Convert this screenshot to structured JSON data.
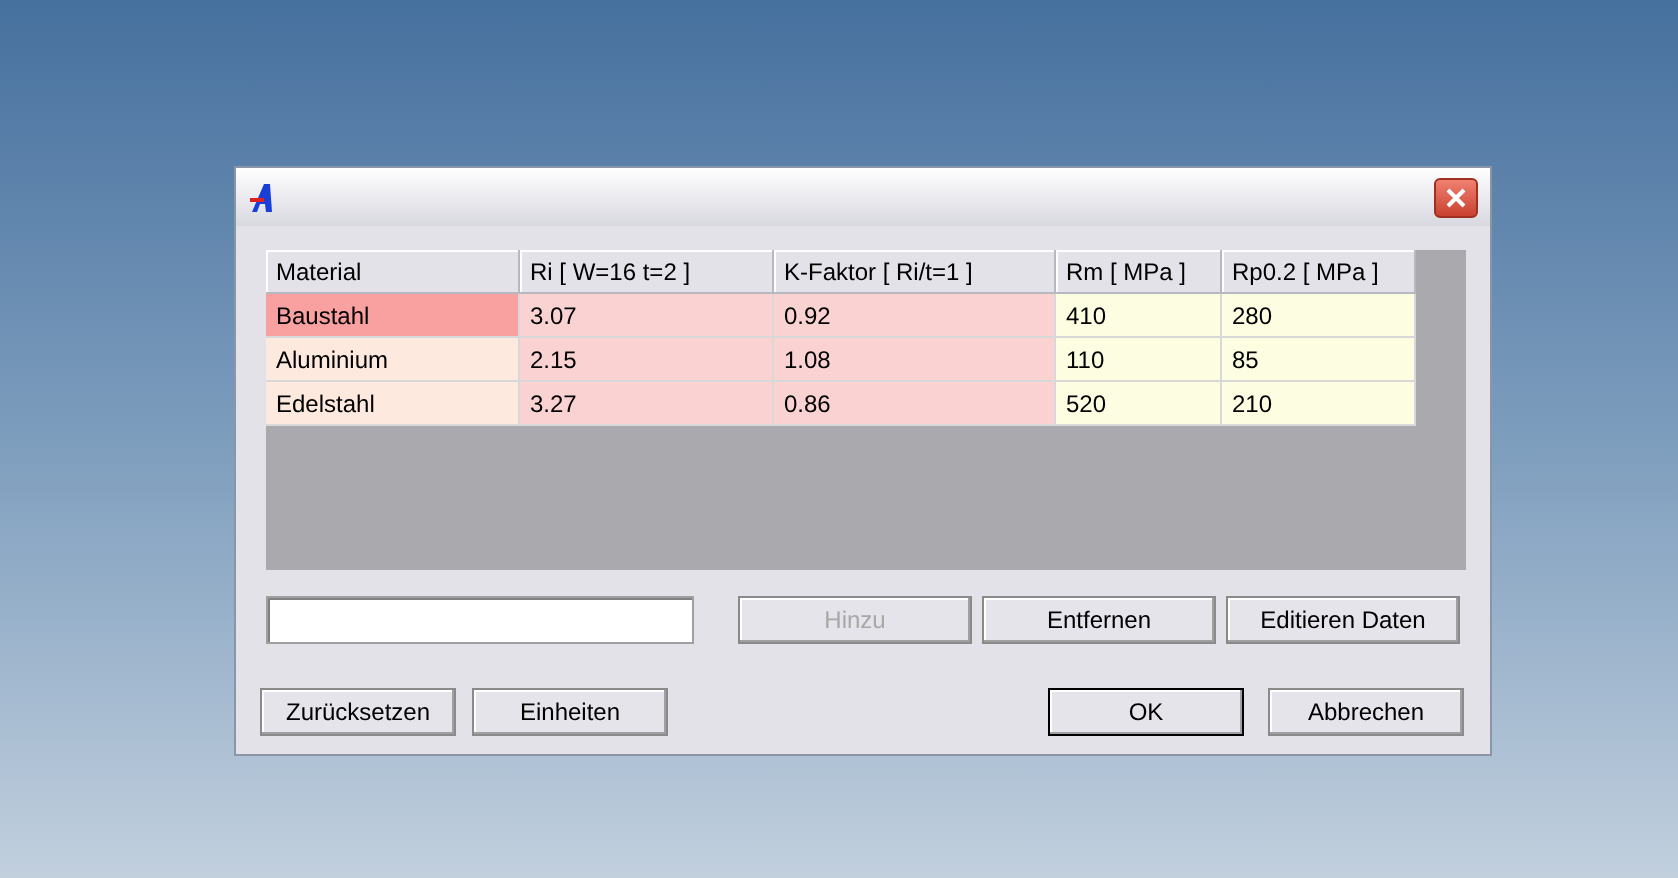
{
  "table": {
    "columns": [
      "Material",
      "Ri [ W=16 t=2 ]",
      "K-Faktor [ Ri/t=1 ]",
      "Rm [ MPa ]",
      "Rp0.2 [ MPa ]"
    ],
    "rows": [
      {
        "selected": true,
        "cells": [
          "Baustahl",
          "3.07",
          "0.92",
          "410",
          "280"
        ]
      },
      {
        "selected": false,
        "cells": [
          "Aluminium",
          "2.15",
          "1.08",
          "110",
          "85"
        ]
      },
      {
        "selected": false,
        "cells": [
          "Edelstahl",
          "3.27",
          "0.86",
          "520",
          "210"
        ]
      }
    ]
  },
  "input": {
    "kind": "text"
  },
  "action_buttons": [
    {
      "label": "Hinzu",
      "disabled": true
    },
    {
      "label": "Entfernen",
      "disabled": false
    },
    {
      "label": "Editieren Daten",
      "disabled": false
    }
  ],
  "footer_left": [
    {
      "label": "Zurücksetzen"
    },
    {
      "label": "Einheiten"
    }
  ],
  "footer_right": [
    {
      "label": "OK",
      "default": true
    },
    {
      "label": "Abbrechen",
      "default": false
    }
  ]
}
